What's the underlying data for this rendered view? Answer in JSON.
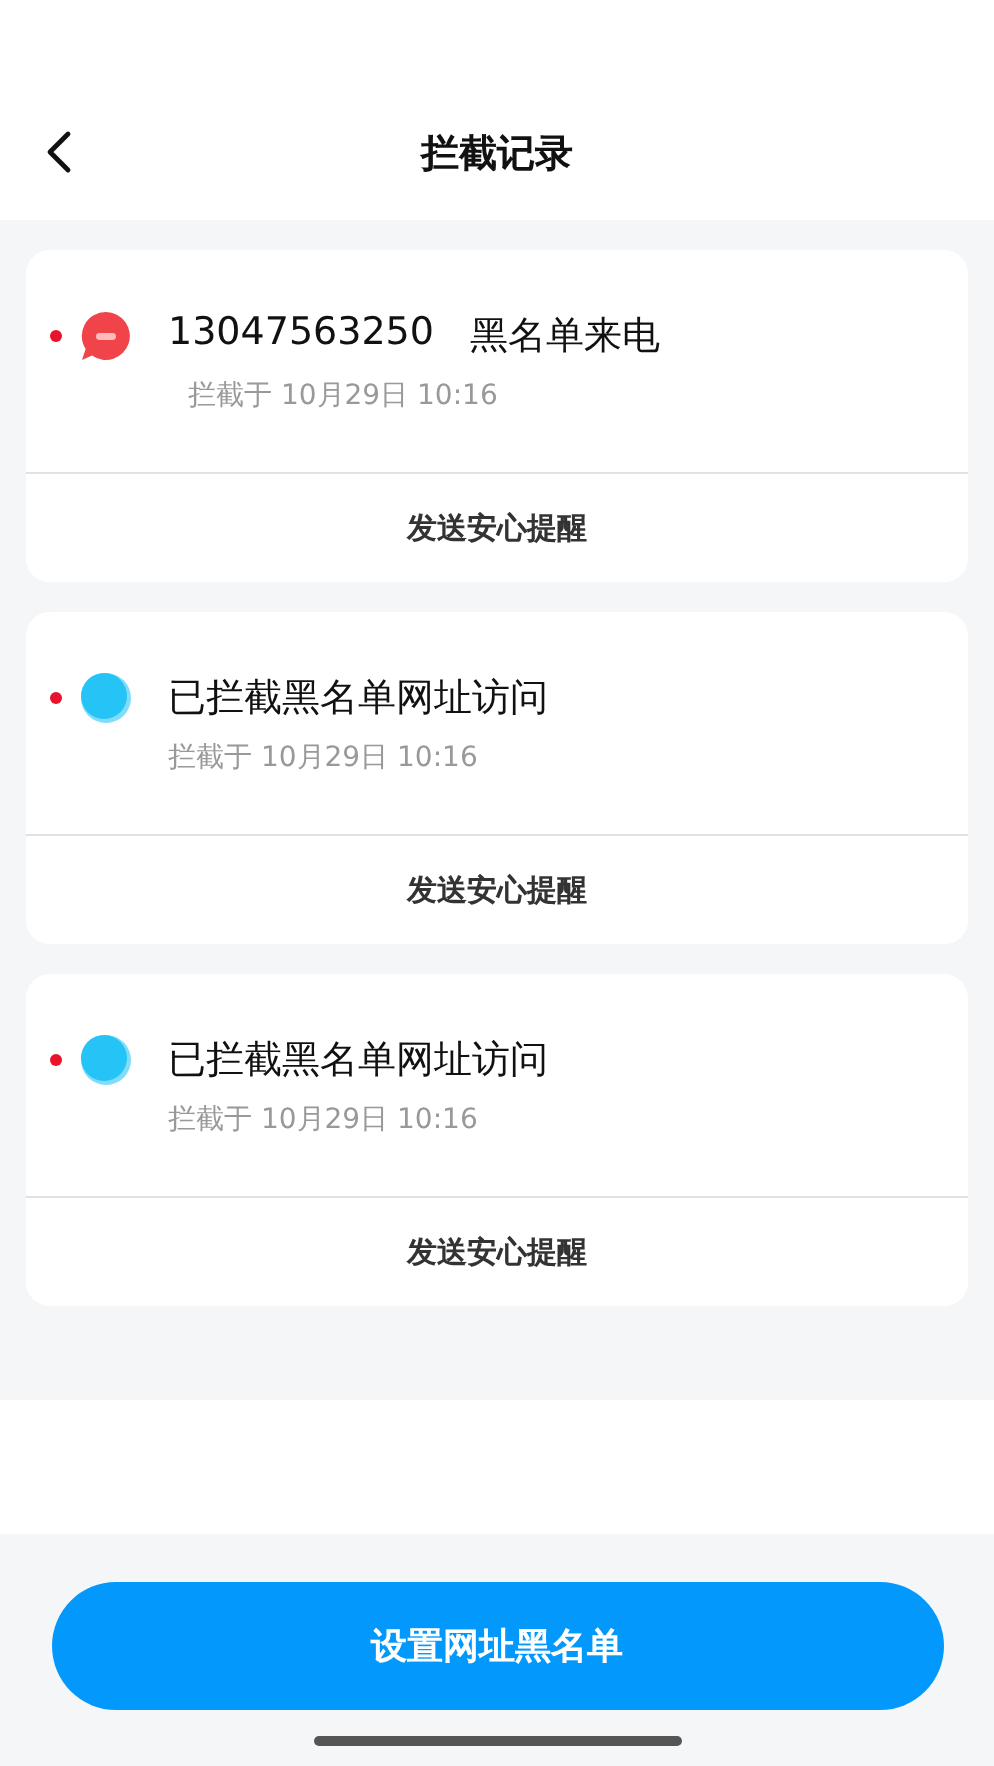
{
  "header": {
    "title": "拦截记录"
  },
  "records": [
    {
      "kind": "call",
      "unread": true,
      "number": "13047563250",
      "title": "黑名单来电",
      "time": "拦截于 10月29日 10:16",
      "action": "发送安心提醒"
    },
    {
      "kind": "web",
      "unread": true,
      "title": "已拦截黑名单网址访问",
      "time": "拦截于 10月29日 10:16",
      "action": "发送安心提醒"
    },
    {
      "kind": "web",
      "unread": true,
      "title": "已拦截黑名单网址访问",
      "time": "拦截于 10月29日 10:16",
      "action": "发送安心提醒"
    }
  ],
  "primary_button": {
    "label": "设置网址黑名单"
  }
}
